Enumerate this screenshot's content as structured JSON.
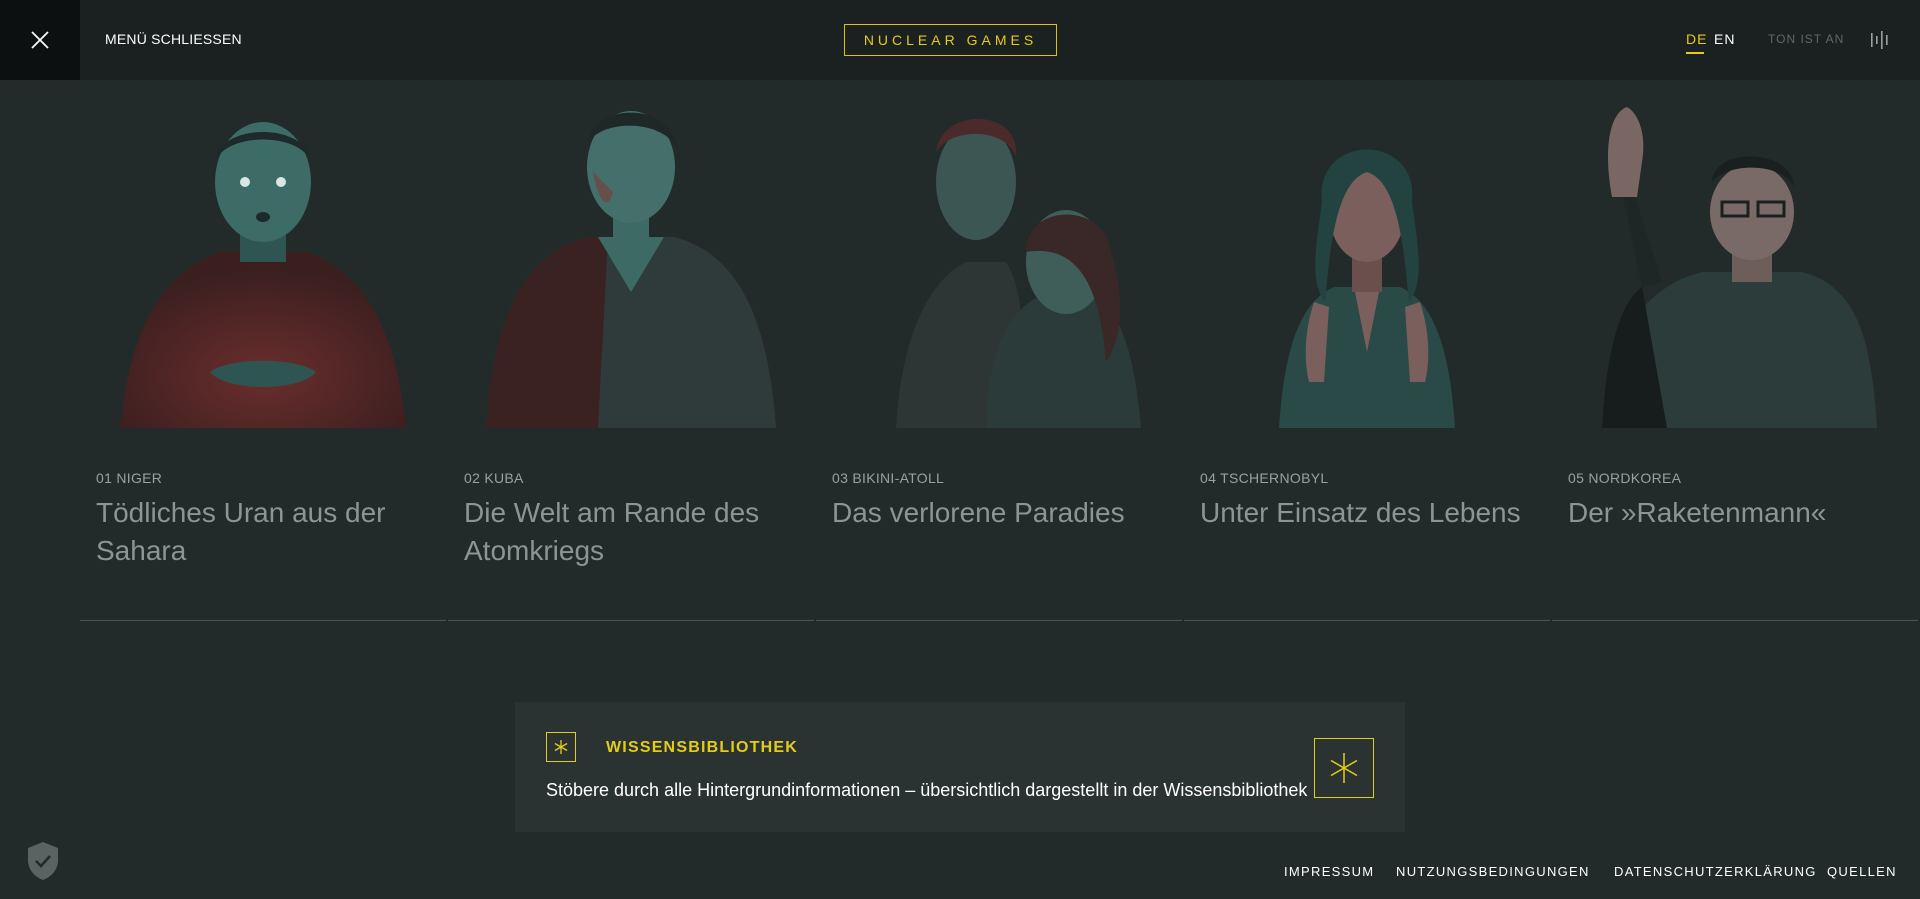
{
  "header": {
    "close_label": "MENÜ SCHLIESSEN",
    "logo": "NUCLEAR GAMES",
    "lang_de": "DE",
    "lang_en": "EN",
    "sound_label": "TON IST AN",
    "icons": [
      "close-icon",
      "sound-bars-icon"
    ]
  },
  "chapters": [
    {
      "number": "01 NIGER",
      "title": "Tödliches Uran aus der Sahara"
    },
    {
      "number": "02 KUBA",
      "title": "Die Welt am Rande des Atomkriegs"
    },
    {
      "number": "03 BIKINI-ATOLL",
      "title": "Das verlorene Paradies"
    },
    {
      "number": "04 TSCHERNOBYL",
      "title": "Unter Einsatz des Lebens"
    },
    {
      "number": "05 NORDKOREA",
      "title": "Der »Raketenmann«"
    }
  ],
  "library": {
    "title": "WISSENSBIBLIOTHEK",
    "text": "Stöbere durch alle Hintergrundinformationen – übersichtlich dargestellt in der Wissensbibliothek",
    "icon": "asterisk-icon"
  },
  "footer": {
    "links": [
      "IMPRESSUM",
      "NUTZUNGSBEDINGUNGEN",
      "DATENSCHUTZERKLÄRUNG",
      "QUELLEN"
    ],
    "privacy_icon": "shield-check-icon"
  },
  "colors": {
    "background": "#232a2a",
    "header": "#1b2020",
    "accent": "#e3cd1b"
  }
}
